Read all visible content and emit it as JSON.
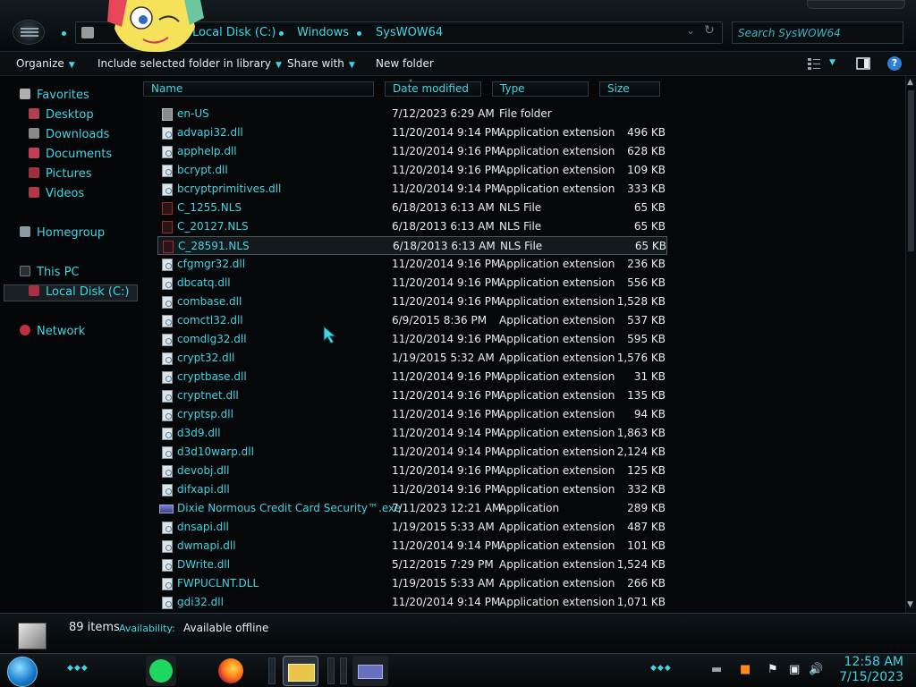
{
  "window": {
    "breadcrumbs": [
      "Local Disk (C:)",
      "Windows",
      "SysWOW64"
    ],
    "search_placeholder": "Search SysWOW64"
  },
  "toolbar": {
    "organize": "Organize",
    "include_library": "Include selected folder in library",
    "share_with": "Share with",
    "new_folder": "New folder"
  },
  "navigation": {
    "favorites": "Favorites",
    "favorites_items": [
      "Desktop",
      "Downloads",
      "Documents",
      "Pictures",
      "Videos"
    ],
    "homegroup": "Homegroup",
    "this_pc": "This PC",
    "local_disk": "Local Disk (C:)",
    "network": "Network"
  },
  "columns": {
    "name": "Name",
    "date_modified": "Date modified",
    "type": "Type",
    "size": "Size"
  },
  "files": [
    {
      "name": "en-US",
      "date": "7/12/2023 6:29 AM",
      "type": "File folder",
      "size": "",
      "icon": "folder-icon"
    },
    {
      "name": "advapi32.dll",
      "date": "11/20/2014 9:14 PM",
      "type": "Application extension",
      "size": "496 KB",
      "icon": "dll-icon"
    },
    {
      "name": "apphelp.dll",
      "date": "11/20/2014 9:16 PM",
      "type": "Application extension",
      "size": "628 KB",
      "icon": "dll-icon"
    },
    {
      "name": "bcrypt.dll",
      "date": "11/20/2014 9:16 PM",
      "type": "Application extension",
      "size": "109 KB",
      "icon": "dll-icon"
    },
    {
      "name": "bcryptprimitives.dll",
      "date": "11/20/2014 9:14 PM",
      "type": "Application extension",
      "size": "333 KB",
      "icon": "dll-icon"
    },
    {
      "name": "C_1255.NLS",
      "date": "6/18/2013 6:13 AM",
      "type": "NLS File",
      "size": "65 KB",
      "icon": "nls-icon"
    },
    {
      "name": "C_20127.NLS",
      "date": "6/18/2013 6:13 AM",
      "type": "NLS File",
      "size": "65 KB",
      "icon": "nls-icon"
    },
    {
      "name": "C_28591.NLS",
      "date": "6/18/2013 6:13 AM",
      "type": "NLS File",
      "size": "65 KB",
      "icon": "nls-icon",
      "selected": true
    },
    {
      "name": "cfgmgr32.dll",
      "date": "11/20/2014 9:16 PM",
      "type": "Application extension",
      "size": "236 KB",
      "icon": "dll-icon"
    },
    {
      "name": "dbcatq.dll",
      "date": "11/20/2014 9:16 PM",
      "type": "Application extension",
      "size": "556 KB",
      "icon": "dll-icon"
    },
    {
      "name": "combase.dll",
      "date": "11/20/2014 9:16 PM",
      "type": "Application extension",
      "size": "1,528 KB",
      "icon": "dll-icon"
    },
    {
      "name": "comctl32.dll",
      "date": "6/9/2015 8:36 PM",
      "type": "Application extension",
      "size": "537 KB",
      "icon": "dll-icon"
    },
    {
      "name": "comdlg32.dll",
      "date": "11/20/2014 9:16 PM",
      "type": "Application extension",
      "size": "595 KB",
      "icon": "dll-icon"
    },
    {
      "name": "crypt32.dll",
      "date": "1/19/2015 5:32 AM",
      "type": "Application extension",
      "size": "1,576 KB",
      "icon": "dll-icon"
    },
    {
      "name": "cryptbase.dll",
      "date": "11/20/2014 9:16 PM",
      "type": "Application extension",
      "size": "31 KB",
      "icon": "dll-icon"
    },
    {
      "name": "cryptnet.dll",
      "date": "11/20/2014 9:16 PM",
      "type": "Application extension",
      "size": "135 KB",
      "icon": "dll-icon"
    },
    {
      "name": "cryptsp.dll",
      "date": "11/20/2014 9:16 PM",
      "type": "Application extension",
      "size": "94 KB",
      "icon": "dll-icon"
    },
    {
      "name": "d3d9.dll",
      "date": "11/20/2014 9:14 PM",
      "type": "Application extension",
      "size": "1,863 KB",
      "icon": "dll-icon"
    },
    {
      "name": "d3d10warp.dll",
      "date": "11/20/2014 9:14 PM",
      "type": "Application extension",
      "size": "2,124 KB",
      "icon": "dll-icon"
    },
    {
      "name": "devobj.dll",
      "date": "11/20/2014 9:16 PM",
      "type": "Application extension",
      "size": "125 KB",
      "icon": "dll-icon"
    },
    {
      "name": "difxapi.dll",
      "date": "11/20/2014 9:16 PM",
      "type": "Application extension",
      "size": "332 KB",
      "icon": "dll-icon"
    },
    {
      "name": "Dixie Normous Credit Card Security™.exe",
      "date": "7/11/2023 12:21 AM",
      "type": "Application",
      "size": "289 KB",
      "icon": "exe-icon"
    },
    {
      "name": "dnsapi.dll",
      "date": "1/19/2015 5:33 AM",
      "type": "Application extension",
      "size": "487 KB",
      "icon": "dll-icon"
    },
    {
      "name": "dwmapi.dll",
      "date": "11/20/2014 9:14 PM",
      "type": "Application extension",
      "size": "101 KB",
      "icon": "dll-icon"
    },
    {
      "name": "DWrite.dll",
      "date": "5/12/2015 7:29 PM",
      "type": "Application extension",
      "size": "1,524 KB",
      "icon": "dll-icon"
    },
    {
      "name": "FWPUCLNT.DLL",
      "date": "1/19/2015 5:33 AM",
      "type": "Application extension",
      "size": "266 KB",
      "icon": "dll-icon"
    },
    {
      "name": "gdi32.dll",
      "date": "11/20/2014 9:14 PM",
      "type": "Application extension",
      "size": "1,071 KB",
      "icon": "dll-icon"
    }
  ],
  "status": {
    "count": "89 items",
    "availability_label": "Availability:",
    "availability_value": "Available offline"
  },
  "taskbar": {
    "time": "12:58 AM",
    "date": "7/15/2023"
  },
  "colors": {
    "accent": "#3fd6e6",
    "background": "#050608",
    "text": "#e6eef2"
  }
}
